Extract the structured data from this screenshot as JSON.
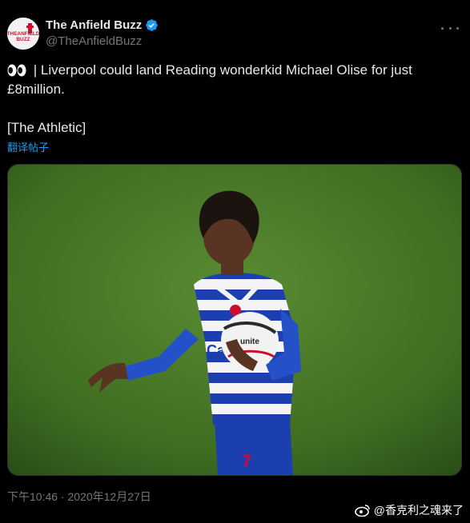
{
  "tweet": {
    "author_name": "The Anfield Buzz",
    "author_handle": "@TheAnfieldBuzz",
    "text_line1": " | Liverpool could land Reading wonderkid Michael Olise for just",
    "text_line2": "£8million.",
    "source": "[The Athletic]",
    "translate_label": "翻译帖子",
    "timestamp": "下午10:46 · 2020年12月27日"
  },
  "media": {
    "description_icon": "photo-of-footballer",
    "shirt_sponsor": "Casumo",
    "ball_brand": "unite"
  },
  "watermark": {
    "text": "@香克利之魂来了",
    "icon": "weibo-icon"
  },
  "colors": {
    "background": "#000000",
    "text": "#e7e9ea",
    "muted": "#71767b",
    "link": "#1d9bf0",
    "verified": "#1d9bf0"
  }
}
